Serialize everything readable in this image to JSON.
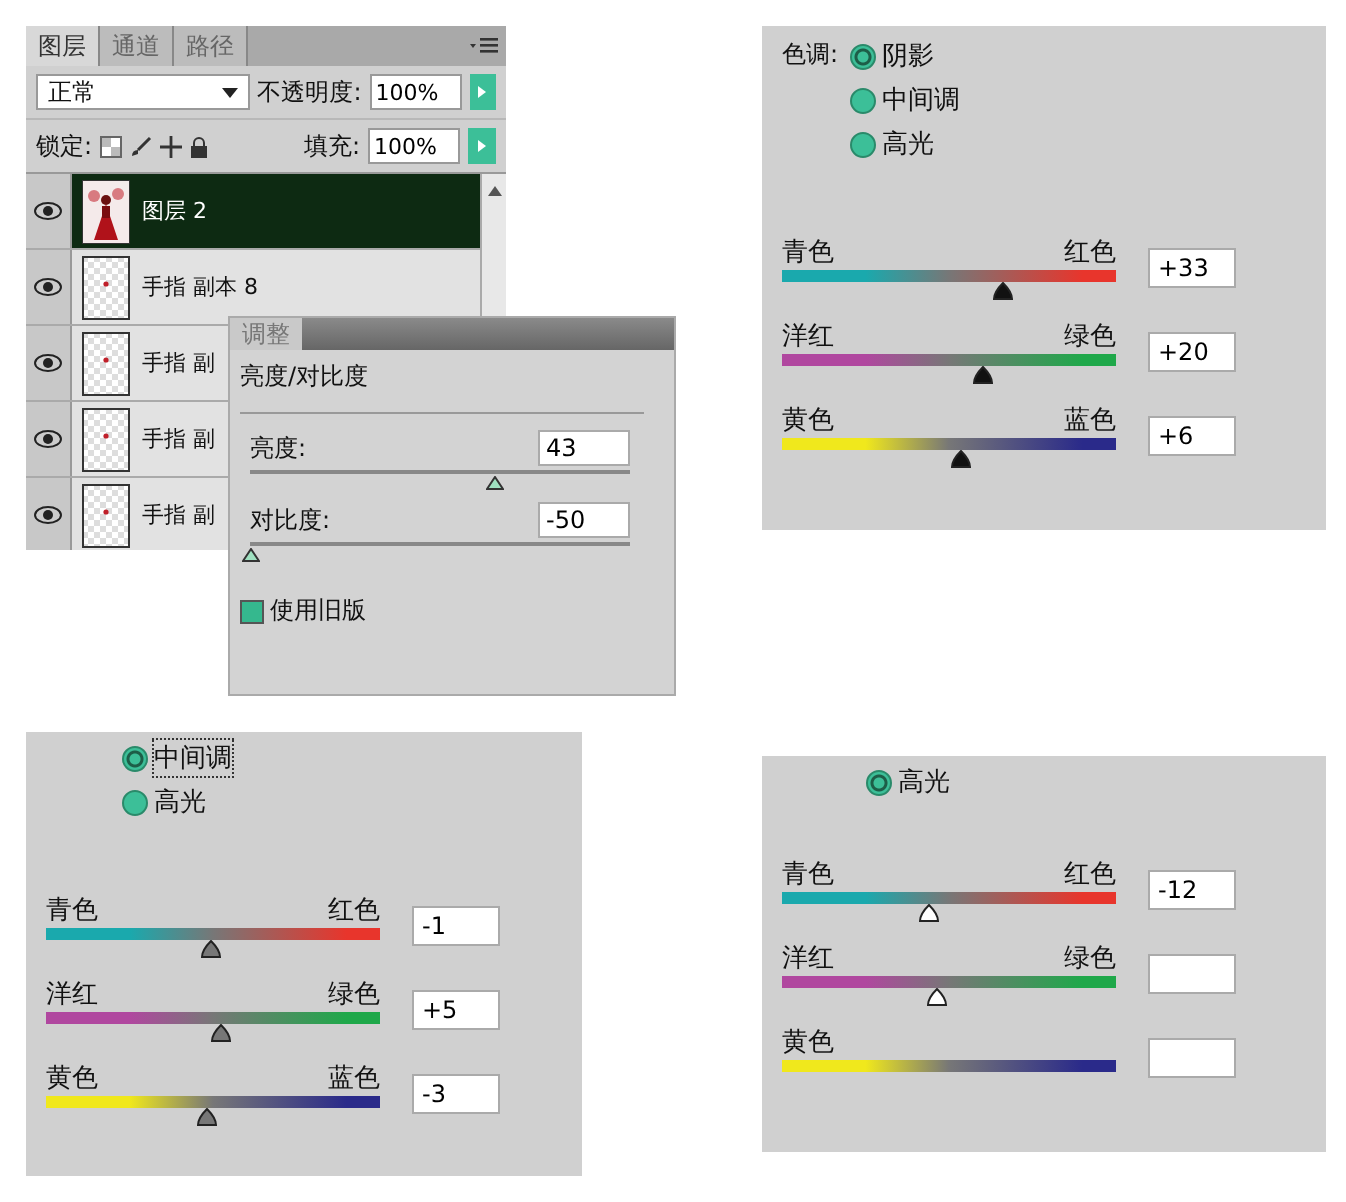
{
  "layers_panel": {
    "tabs": [
      {
        "label": "图层",
        "selected": true
      },
      {
        "label": "通道",
        "selected": false
      },
      {
        "label": "路径",
        "selected": false
      }
    ],
    "blend_mode": "正常",
    "opacity_label": "不透明度:",
    "opacity": "100%",
    "lock_label": "锁定:",
    "fill_label": "填充:",
    "fill": "100%",
    "layers": [
      {
        "name": "图层 2",
        "visible": true,
        "selected": true,
        "kind": "picture"
      },
      {
        "name": "手指 副本 8",
        "visible": true,
        "selected": false,
        "kind": "transparent"
      },
      {
        "name": "手指 副",
        "visible": true,
        "selected": false,
        "kind": "transparent"
      },
      {
        "name": "手指 副",
        "visible": true,
        "selected": false,
        "kind": "transparent"
      },
      {
        "name": "手指 副",
        "visible": true,
        "selected": false,
        "kind": "transparent"
      }
    ]
  },
  "adjustments_panel": {
    "tab": "调整",
    "title": "亮度/对比度",
    "sliders": [
      {
        "label": "亮度:",
        "value": "43",
        "level": 0.64
      },
      {
        "label": "对比度:",
        "value": "-50",
        "level": 0
      }
    ],
    "legacy": {
      "label": "使用旧版",
      "checked": true
    }
  },
  "color_balance_panels": [
    {
      "kind": "shadows",
      "tone_label": "色调:",
      "tones": [
        {
          "label": "阴影",
          "selected": true
        },
        {
          "label": "中间调",
          "selected": false
        },
        {
          "label": "高光",
          "selected": false
        }
      ],
      "sliders": [
        {
          "left": "青色",
          "right": "红色",
          "value": "+33",
          "level": 0.66
        },
        {
          "left": "洋红",
          "right": "绿色",
          "value": "+20",
          "level": 0.6
        },
        {
          "left": "黄色",
          "right": "蓝色",
          "value": "+6",
          "level": 0.53
        }
      ]
    },
    {
      "kind": "midtones",
      "tones": [
        {
          "label": "中间调",
          "selected": true
        },
        {
          "label": "高光",
          "selected": false
        }
      ],
      "sliders": [
        {
          "left": "青色",
          "right": "红色",
          "value": "-1",
          "level": 0.49
        },
        {
          "left": "洋红",
          "right": "绿色",
          "value": "+5",
          "level": 0.52
        },
        {
          "left": "黄色",
          "right": "蓝色",
          "value": "-3",
          "level": 0.48
        }
      ]
    },
    {
      "kind": "highlights",
      "tones": [
        {
          "label": "高光",
          "selected": true
        }
      ],
      "sliders": [
        {
          "left": "青色",
          "right": "红色",
          "value": "-12",
          "level": 0.44
        },
        {
          "left": "洋红",
          "right": "绿色",
          "level": 0.46
        },
        {
          "left": "黄色"
        }
      ]
    }
  ]
}
